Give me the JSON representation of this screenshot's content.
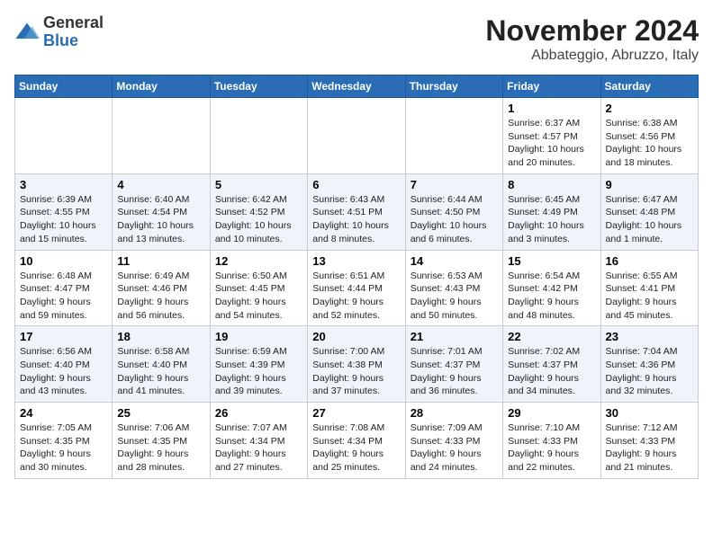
{
  "logo": {
    "general": "General",
    "blue": "Blue"
  },
  "title": "November 2024",
  "subtitle": "Abbateggio, Abruzzo, Italy",
  "days_header": [
    "Sunday",
    "Monday",
    "Tuesday",
    "Wednesday",
    "Thursday",
    "Friday",
    "Saturday"
  ],
  "weeks": [
    [
      {
        "day": "",
        "info": ""
      },
      {
        "day": "",
        "info": ""
      },
      {
        "day": "",
        "info": ""
      },
      {
        "day": "",
        "info": ""
      },
      {
        "day": "",
        "info": ""
      },
      {
        "day": "1",
        "info": "Sunrise: 6:37 AM\nSunset: 4:57 PM\nDaylight: 10 hours\nand 20 minutes."
      },
      {
        "day": "2",
        "info": "Sunrise: 6:38 AM\nSunset: 4:56 PM\nDaylight: 10 hours\nand 18 minutes."
      }
    ],
    [
      {
        "day": "3",
        "info": "Sunrise: 6:39 AM\nSunset: 4:55 PM\nDaylight: 10 hours\nand 15 minutes."
      },
      {
        "day": "4",
        "info": "Sunrise: 6:40 AM\nSunset: 4:54 PM\nDaylight: 10 hours\nand 13 minutes."
      },
      {
        "day": "5",
        "info": "Sunrise: 6:42 AM\nSunset: 4:52 PM\nDaylight: 10 hours\nand 10 minutes."
      },
      {
        "day": "6",
        "info": "Sunrise: 6:43 AM\nSunset: 4:51 PM\nDaylight: 10 hours\nand 8 minutes."
      },
      {
        "day": "7",
        "info": "Sunrise: 6:44 AM\nSunset: 4:50 PM\nDaylight: 10 hours\nand 6 minutes."
      },
      {
        "day": "8",
        "info": "Sunrise: 6:45 AM\nSunset: 4:49 PM\nDaylight: 10 hours\nand 3 minutes."
      },
      {
        "day": "9",
        "info": "Sunrise: 6:47 AM\nSunset: 4:48 PM\nDaylight: 10 hours\nand 1 minute."
      }
    ],
    [
      {
        "day": "10",
        "info": "Sunrise: 6:48 AM\nSunset: 4:47 PM\nDaylight: 9 hours\nand 59 minutes."
      },
      {
        "day": "11",
        "info": "Sunrise: 6:49 AM\nSunset: 4:46 PM\nDaylight: 9 hours\nand 56 minutes."
      },
      {
        "day": "12",
        "info": "Sunrise: 6:50 AM\nSunset: 4:45 PM\nDaylight: 9 hours\nand 54 minutes."
      },
      {
        "day": "13",
        "info": "Sunrise: 6:51 AM\nSunset: 4:44 PM\nDaylight: 9 hours\nand 52 minutes."
      },
      {
        "day": "14",
        "info": "Sunrise: 6:53 AM\nSunset: 4:43 PM\nDaylight: 9 hours\nand 50 minutes."
      },
      {
        "day": "15",
        "info": "Sunrise: 6:54 AM\nSunset: 4:42 PM\nDaylight: 9 hours\nand 48 minutes."
      },
      {
        "day": "16",
        "info": "Sunrise: 6:55 AM\nSunset: 4:41 PM\nDaylight: 9 hours\nand 45 minutes."
      }
    ],
    [
      {
        "day": "17",
        "info": "Sunrise: 6:56 AM\nSunset: 4:40 PM\nDaylight: 9 hours\nand 43 minutes."
      },
      {
        "day": "18",
        "info": "Sunrise: 6:58 AM\nSunset: 4:40 PM\nDaylight: 9 hours\nand 41 minutes."
      },
      {
        "day": "19",
        "info": "Sunrise: 6:59 AM\nSunset: 4:39 PM\nDaylight: 9 hours\nand 39 minutes."
      },
      {
        "day": "20",
        "info": "Sunrise: 7:00 AM\nSunset: 4:38 PM\nDaylight: 9 hours\nand 37 minutes."
      },
      {
        "day": "21",
        "info": "Sunrise: 7:01 AM\nSunset: 4:37 PM\nDaylight: 9 hours\nand 36 minutes."
      },
      {
        "day": "22",
        "info": "Sunrise: 7:02 AM\nSunset: 4:37 PM\nDaylight: 9 hours\nand 34 minutes."
      },
      {
        "day": "23",
        "info": "Sunrise: 7:04 AM\nSunset: 4:36 PM\nDaylight: 9 hours\nand 32 minutes."
      }
    ],
    [
      {
        "day": "24",
        "info": "Sunrise: 7:05 AM\nSunset: 4:35 PM\nDaylight: 9 hours\nand 30 minutes."
      },
      {
        "day": "25",
        "info": "Sunrise: 7:06 AM\nSunset: 4:35 PM\nDaylight: 9 hours\nand 28 minutes."
      },
      {
        "day": "26",
        "info": "Sunrise: 7:07 AM\nSunset: 4:34 PM\nDaylight: 9 hours\nand 27 minutes."
      },
      {
        "day": "27",
        "info": "Sunrise: 7:08 AM\nSunset: 4:34 PM\nDaylight: 9 hours\nand 25 minutes."
      },
      {
        "day": "28",
        "info": "Sunrise: 7:09 AM\nSunset: 4:33 PM\nDaylight: 9 hours\nand 24 minutes."
      },
      {
        "day": "29",
        "info": "Sunrise: 7:10 AM\nSunset: 4:33 PM\nDaylight: 9 hours\nand 22 minutes."
      },
      {
        "day": "30",
        "info": "Sunrise: 7:12 AM\nSunset: 4:33 PM\nDaylight: 9 hours\nand 21 minutes."
      }
    ]
  ]
}
